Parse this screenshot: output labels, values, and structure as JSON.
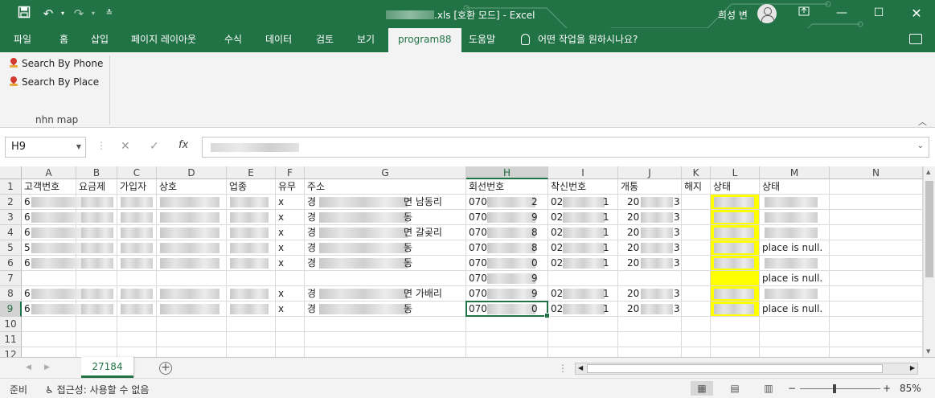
{
  "titlebar": {
    "filename_suffix": ".xls",
    "mode": "[호환 모드]",
    "separator": "-",
    "app": "Excel",
    "user": "희성 변",
    "icons": [
      "save-icon",
      "undo-icon",
      "redo-icon",
      "customize-qat-icon",
      "ribbon-display-icon",
      "minimize-icon",
      "maximize-icon",
      "close-icon"
    ]
  },
  "ribbon_tabs": [
    "파일",
    "홈",
    "삽입",
    "페이지 레이아웃",
    "수식",
    "데이터",
    "검토",
    "보기",
    "program88",
    "도움말"
  ],
  "active_tab": "program88",
  "tell_me": "어떤 작업을 원하시나요?",
  "ribbon": {
    "buttons": [
      "Search By Phone",
      "Search By Place"
    ],
    "group_label": "nhn map"
  },
  "formula_bar": {
    "name_box": "H9",
    "fx": "fx"
  },
  "columns": [
    "A",
    "B",
    "C",
    "D",
    "E",
    "F",
    "G",
    "H",
    "I",
    "J",
    "K",
    "L",
    "M",
    "N"
  ],
  "selected_column": "H",
  "rows": [
    "1",
    "2",
    "3",
    "4",
    "5",
    "6",
    "7",
    "8",
    "9",
    "10",
    "11",
    "12"
  ],
  "selected_row": "9",
  "headers": [
    "고객번호",
    "요금제",
    "가입자",
    "상호",
    "업종",
    "유무",
    "주소",
    "회선번호",
    "착신번호",
    "개통",
    "해지",
    "상태",
    "상태"
  ],
  "data_rows": [
    {
      "a": "6",
      "f": "x",
      "g": "경",
      "g_tail": "면 남동리",
      "h": "070",
      "h_end": "2",
      "i": "02",
      "i_end": "1",
      "j": "20",
      "j_end": "3",
      "m": ""
    },
    {
      "a": "6",
      "f": "x",
      "g": "경",
      "g_tail": "동",
      "h": "070",
      "h_end": "9",
      "i": "02",
      "i_end": "1",
      "j": "20",
      "j_end": "3",
      "m": ""
    },
    {
      "a": "6",
      "f": "x",
      "g": "경",
      "g_tail": "면 갈곶리",
      "h": "070",
      "h_end": "8",
      "i": "02",
      "i_end": "1",
      "j": "20",
      "j_end": "3",
      "m": ""
    },
    {
      "a": "5",
      "f": "x",
      "g": "경",
      "g_tail": "동",
      "h": "070",
      "h_end": "8",
      "i": "02",
      "i_end": "1",
      "j": "20",
      "j_end": "3",
      "m": "place is null."
    },
    {
      "a": "6",
      "f": "x",
      "g": "경",
      "g_tail": "동",
      "h": "070",
      "h_end": "0",
      "i": "02",
      "i_end": "1",
      "j": "20",
      "j_end": "3",
      "m": ""
    },
    {
      "a": "",
      "f": "",
      "g": "",
      "g_tail": "",
      "h": "070",
      "h_end": "9",
      "i": "",
      "i_end": "",
      "j": "",
      "j_end": "",
      "m": "place is null."
    },
    {
      "a": "6",
      "f": "x",
      "g": "경",
      "g_tail": "면 가배리",
      "h": "070",
      "h_end": "9",
      "i": "02",
      "i_end": "1",
      "j": "20",
      "j_end": "3",
      "m": ""
    },
    {
      "a": "6",
      "f": "x",
      "g": "경",
      "g_tail": "동",
      "h": "070",
      "h_end": "0",
      "i": "02",
      "i_end": "1",
      "j": "20",
      "j_end": "3",
      "m": "place is null."
    }
  ],
  "sheet_tab": "27184",
  "status": {
    "ready": "준비",
    "accessibility": "접근성: 사용할 수 없음",
    "zoom_minus": "−",
    "zoom_plus": "+",
    "zoom": "85%"
  },
  "colors": {
    "brand_green": "#217346",
    "highlight_yellow": "#ffff00"
  }
}
